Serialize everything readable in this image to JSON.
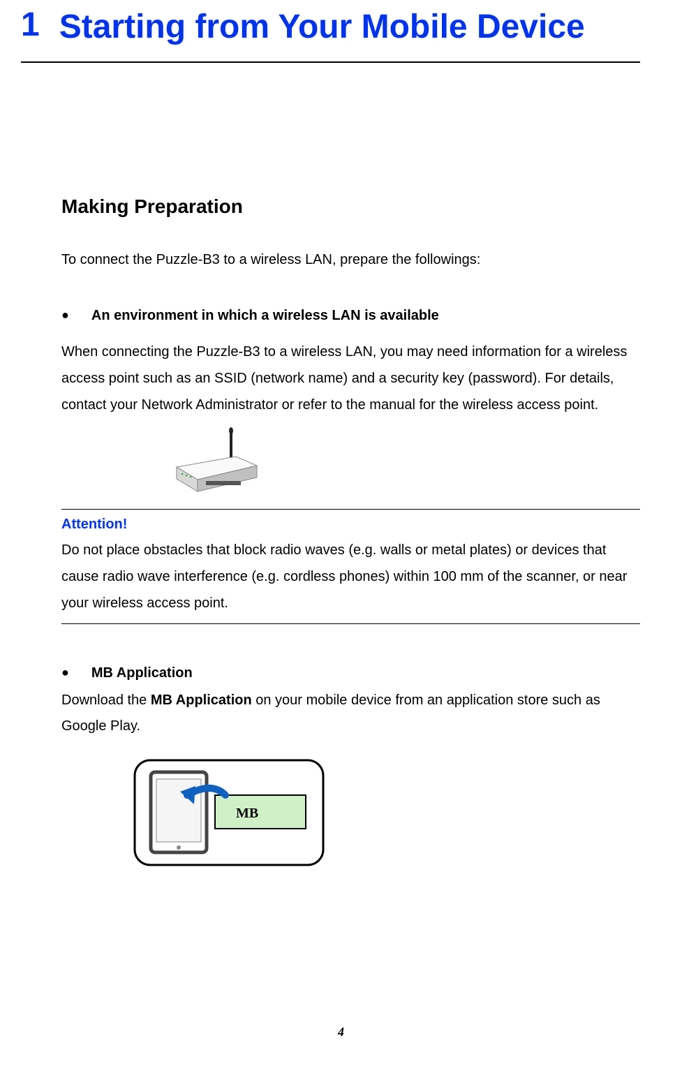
{
  "chapter": {
    "number": "1",
    "title": "Starting from Your Mobile Device"
  },
  "section_heading": "Making Preparation",
  "intro": "To connect the Puzzle-B3 to a wireless LAN, prepare the followings:",
  "bullet1": {
    "label": "An environment in which a wireless LAN is available",
    "body": "When connecting the Puzzle-B3 to a wireless LAN, you may need information for a wireless access point such as an SSID (network name) and a security key (password). For details, contact your Network Administrator or refer to the manual for the wireless access point."
  },
  "attention": {
    "title": "Attention!",
    "body": "Do not place obstacles that block radio waves (e.g. walls or metal plates) or devices that cause radio wave interference (e.g. cordless phones) within 100 mm of the scanner, or near your wireless access point."
  },
  "bullet2": {
    "label": "MB Application",
    "body_pre": "Download the ",
    "body_bold": "MB Application",
    "body_post": " on your mobile device from an application store such as Google Play."
  },
  "mb_label": "MB",
  "page_number": "4"
}
